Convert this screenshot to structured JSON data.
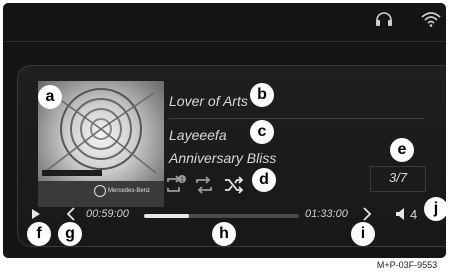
{
  "status_bar": {
    "headphones_icon": "headphones-icon",
    "wifi_icon": "wifi-icon"
  },
  "now_playing": {
    "track": "Lover of Arts",
    "artist": "Layeeefa",
    "album": "Anniversary Bliss",
    "counter": "3/7",
    "elapsed": "00:59:00",
    "total": "01:33:00",
    "progress_fraction": 0.29,
    "volume": "4",
    "cover_brand": "Mercedes-Benz"
  },
  "controls": {
    "repeat_one_icon": "repeat-track-icon",
    "repeat_icon": "repeat-icon",
    "shuffle_icon": "shuffle-icon",
    "play_icon": "play-icon",
    "prev_icon": "chevron-left-icon",
    "next_icon": "chevron-right-icon",
    "volume_icon": "speaker-icon"
  },
  "markers": {
    "a": "a",
    "b": "b",
    "c": "c",
    "d": "d",
    "e": "e",
    "f": "f",
    "g": "g",
    "h": "h",
    "i": "i",
    "j": "j"
  },
  "caption": "M+P-03F-9553",
  "colors": {
    "background": "#151515",
    "text": "#d8d8d8",
    "accent": "#ffffff"
  }
}
